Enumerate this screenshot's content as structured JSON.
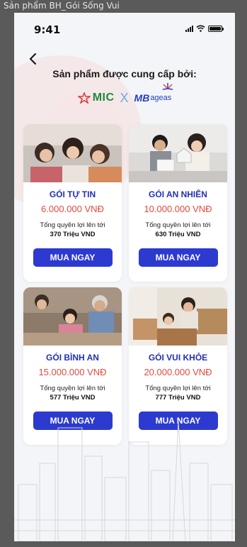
{
  "window_title": "Sản phẩm BH_Gói Sống Vui",
  "status_bar": {
    "time": "9:41"
  },
  "header": {
    "title": "Sản phẩm được cung cấp bởi:"
  },
  "partners": {
    "mic": "MIC",
    "separator": "X",
    "mb": "MB",
    "ageas": "ageas"
  },
  "colors": {
    "accent": "#2c3ad0",
    "title_blue": "#2230b5",
    "price_red": "#e04a3f",
    "mic_green": "#1e8a3c"
  },
  "products": [
    {
      "name": "GÓI TỰ TIN",
      "price": "6.000.000 VNĐ",
      "desc": "Tổng quyền lợi lên tới",
      "total": "370 Triệu VND",
      "cta": "MUA NGAY"
    },
    {
      "name": "GÓI AN NHIÊN",
      "price": "10.000.000 VNĐ",
      "desc": "Tổng quyền lợi lên tới",
      "total": "630 Triệu VND",
      "cta": "MUA NGAY"
    },
    {
      "name": "GÓI BÌNH AN",
      "price": "15.000.000 VNĐ",
      "desc": "Tổng quyền lợi lên tới",
      "total": "577 Triệu VND",
      "cta": "MUA NGAY"
    },
    {
      "name": "GÓI VUI KHỎE",
      "price": "20.000.000 VNĐ",
      "desc": "Tổng quyền lợi lên tới",
      "total": "777 Triệu VND",
      "cta": "MUA NGAY"
    }
  ]
}
